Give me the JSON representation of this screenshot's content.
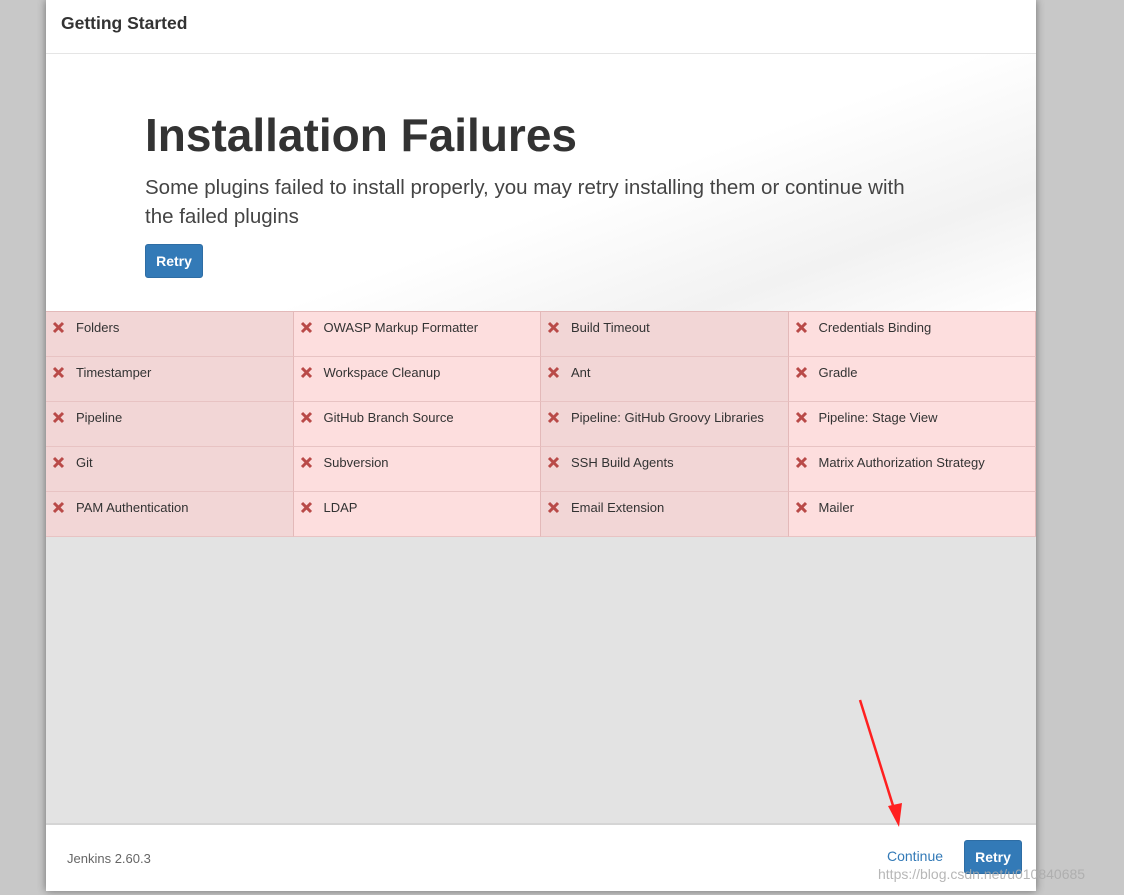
{
  "header": {
    "title": "Getting Started"
  },
  "hero": {
    "title": "Installation Failures",
    "subtitle": "Some plugins failed to install properly, you may retry installing them or continue with the failed plugins",
    "retry_label": "Retry"
  },
  "plugins": [
    [
      "Folders",
      "OWASP Markup Formatter",
      "Build Timeout",
      "Credentials Binding"
    ],
    [
      "Timestamper",
      "Workspace Cleanup",
      "Ant",
      "Gradle"
    ],
    [
      "Pipeline",
      "GitHub Branch Source",
      "Pipeline: GitHub Groovy Libraries",
      "Pipeline: Stage View"
    ],
    [
      "Git",
      "Subversion",
      "SSH Build Agents",
      "Matrix Authorization Strategy"
    ],
    [
      "PAM Authentication",
      "LDAP",
      "Email Extension",
      "Mailer"
    ]
  ],
  "footer": {
    "version": "Jenkins 2.60.3",
    "continue_label": "Continue",
    "retry_label": "Retry"
  },
  "watermark": "https://blog.csdn.net/u010840685",
  "colors": {
    "failed_icon": "#b94a48",
    "primary_button": "#337ab7",
    "annotation_arrow": "#ff2020"
  }
}
